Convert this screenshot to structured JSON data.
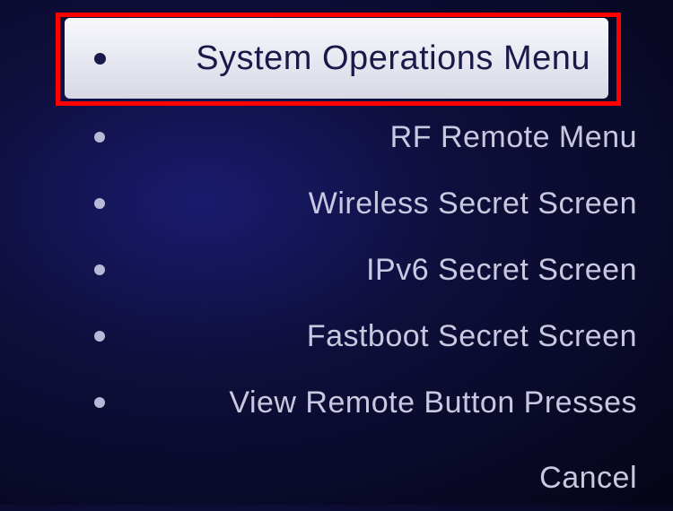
{
  "menu": {
    "items": [
      {
        "label": "System Operations Menu",
        "selected": true,
        "highlighted": true
      },
      {
        "label": "RF Remote Menu",
        "selected": false
      },
      {
        "label": "Wireless Secret Screen",
        "selected": false
      },
      {
        "label": "IPv6 Secret Screen",
        "selected": false
      },
      {
        "label": "Fastboot Secret Screen",
        "selected": false
      },
      {
        "label": "View Remote Button Presses",
        "selected": false
      },
      {
        "label": "Cancel",
        "selected": false,
        "cancel": true
      }
    ]
  }
}
